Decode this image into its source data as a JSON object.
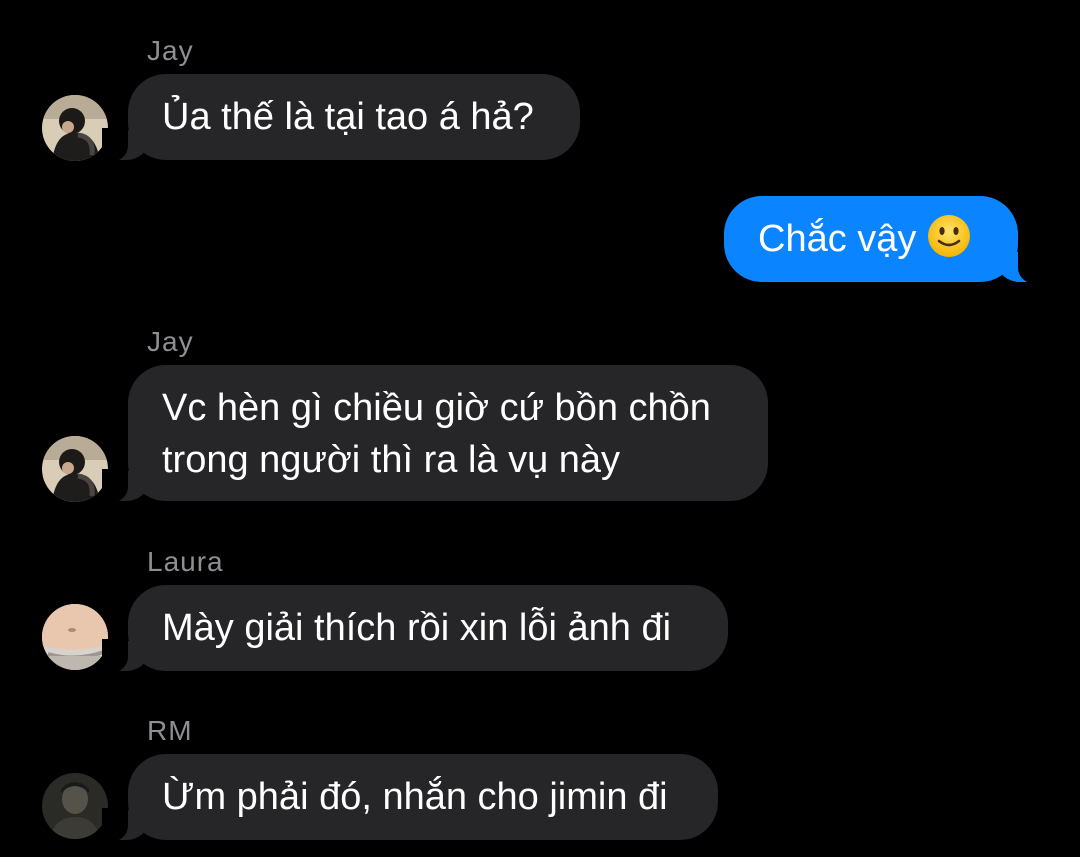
{
  "messages": [
    {
      "sender": "Jay",
      "avatar": "jay-avatar",
      "text": "Ủa thế là tại tao á hả?"
    },
    {
      "sender": "me",
      "text": "Chắc vậy",
      "emoji": "slightly-smiling-face-icon"
    },
    {
      "sender": "Jay",
      "avatar": "jay-avatar",
      "lines": [
        "Vc hèn gì chiều giờ cứ bồn chồn",
        "trong người thì ra là vụ này"
      ]
    },
    {
      "sender": "Laura",
      "avatar": "laura-avatar",
      "text": "Mày giải thích rồi xin lỗi ảnh đi"
    },
    {
      "sender": "RM",
      "avatar": "rm-avatar",
      "text": "Ừm phải đó, nhắn cho jimin đi"
    }
  ],
  "colors": {
    "background": "#000000",
    "incoming_bubble": "#262629",
    "outgoing_bubble": "#0a84ff",
    "sender_name": "#8e8e93"
  }
}
